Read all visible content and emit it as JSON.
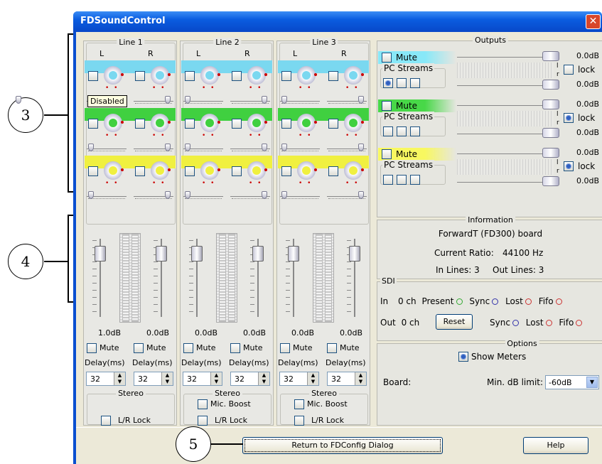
{
  "window": {
    "title": "FDSoundControl",
    "close_glyph": "✕"
  },
  "callouts": {
    "c3": "3",
    "c4": "4",
    "c5": "5"
  },
  "lines": [
    {
      "name": "Line 1",
      "left": "L",
      "right": "R",
      "level_l": "1.0dB",
      "level_r": "0.0dB",
      "mute": "Mute",
      "delay_label": "Delay(ms)",
      "delay_l": "32",
      "delay_r": "32",
      "stereo_title": "Stereo",
      "lr_lock": "L/R Lock",
      "mic_boost": ""
    },
    {
      "name": "Line 2",
      "left": "L",
      "right": "R",
      "level_l": "0.0dB",
      "level_r": "0.0dB",
      "mute": "Mute",
      "delay_label": "Delay(ms)",
      "delay_l": "32",
      "delay_r": "32",
      "stereo_title": "Stereo",
      "lr_lock": "L/R Lock",
      "mic_boost": "Mic. Boost"
    },
    {
      "name": "Line 3",
      "left": "L",
      "right": "R",
      "level_l": "0.0dB",
      "level_r": "0.0dB",
      "mute": "Mute",
      "delay_label": "Delay(ms)",
      "delay_l": "32",
      "delay_r": "32",
      "stereo_title": "Stereo",
      "lr_lock": "L/R Lock",
      "mic_boost": "Mic. Boost"
    }
  ],
  "tooltip": "Disabled",
  "band_colors": [
    "#7ad8f0",
    "#40d040",
    "#f0f040"
  ],
  "outputs": {
    "title": "Outputs",
    "rows": [
      {
        "mute": "Mute",
        "streams": "PC Streams",
        "top_db": "0.0dB",
        "bot_db": "0.0dB",
        "lock": "lock",
        "lock_on": false,
        "color": "#88e8f8"
      },
      {
        "mute": "Mute",
        "streams": "PC Streams",
        "top_db": "0.0dB",
        "bot_db": "0.0dB",
        "lock": "lock",
        "lock_on": true,
        "color": "#48d848"
      },
      {
        "mute": "Mute",
        "streams": "PC Streams",
        "top_db": "0.0dB",
        "bot_db": "0.0dB",
        "lock": "lock",
        "lock_on": true,
        "color": "#f8f860"
      }
    ],
    "meter_labels": [
      "l",
      "r"
    ]
  },
  "information": {
    "title": "Information",
    "board": "ForwardT (FD300) board",
    "ratio_label": "Current Ratio:",
    "ratio_value": "44100 Hz",
    "in_lines": "In Lines: 3",
    "out_lines": "Out Lines: 3"
  },
  "sdi": {
    "title": "SDI",
    "in_label": "In",
    "in_ch": "0 ch",
    "present": "Present",
    "out_label": "Out",
    "out_ch": "0 ch",
    "reset": "Reset",
    "sync": "Sync",
    "lost": "Lost",
    "fifo": "Fifo"
  },
  "options": {
    "title": "Options",
    "show_meters": "Show Meters",
    "board_label": "Board:",
    "min_db_label": "Min. dB limit:",
    "min_db_value": "-60dB"
  },
  "footer": {
    "return_btn": "Return to FDConfig Dialog",
    "help_btn": "Help"
  }
}
